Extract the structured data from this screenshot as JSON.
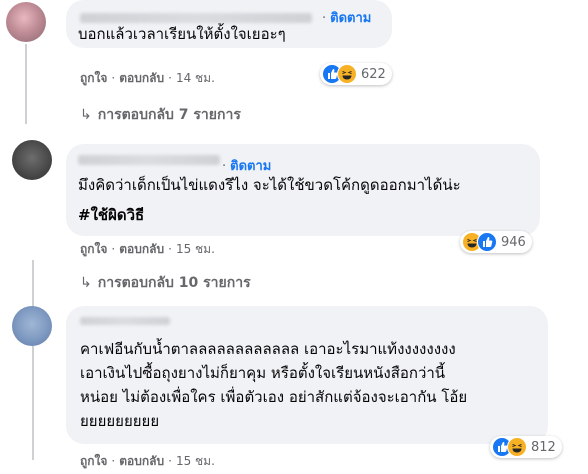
{
  "comments": [
    {
      "follow_label": "ติดตาม",
      "lines": [
        "บอกแล้วเวลาเรียนให้ตั้งใจเยอะๆ"
      ],
      "actions": {
        "like": "ถูกใจ",
        "reply": "ตอบกลับ",
        "time": "14 ชม."
      },
      "reactions": {
        "icons": [
          "like-icon",
          "haha-icon"
        ],
        "count": "622"
      },
      "replies_label": "การตอบกลับ 7 รายการ"
    },
    {
      "follow_label": "ติดตาม",
      "lines": [
        "มึงคิดว่าเด็กเป็นไข่แดงรึไง จะได้ใช้ขวดโค้กดูดออกมาได้น่ะ"
      ],
      "hashtag": "#ใช้ผิดวิธี",
      "actions": {
        "like": "ถูกใจ",
        "reply": "ตอบกลับ",
        "time": "15 ชม."
      },
      "reactions": {
        "icons": [
          "haha-icon",
          "like-icon"
        ],
        "count": "946"
      },
      "replies_label": "การตอบกลับ 10 รายการ"
    },
    {
      "lines": [
        "คาเฟอีนกับน้ำตาลลลลลลลลลลลล เอาอะไรมาแท้งงงงงงงง",
        "เอาเงินไปซื้อถุงยางไม่ก็ยาคุม หรือตั้งใจเรียนหนังสือกว่านี้",
        "หน่อย ไม่ต้องเพื่อใคร เพื่อตัวเอง อย่าสักแต่จ้องจะเอากัน โอ้ย",
        "ยยยยยยยยย"
      ],
      "actions": {
        "like": "ถูกใจ",
        "reply": "ตอบกลับ",
        "time": "15 ชม."
      },
      "reactions": {
        "icons": [
          "like-icon",
          "haha-icon"
        ],
        "count": "812"
      }
    }
  ],
  "colors": {
    "bubble": "#f0f2f5",
    "link": "#1877f2",
    "meta": "#65676b",
    "text": "#050505"
  }
}
